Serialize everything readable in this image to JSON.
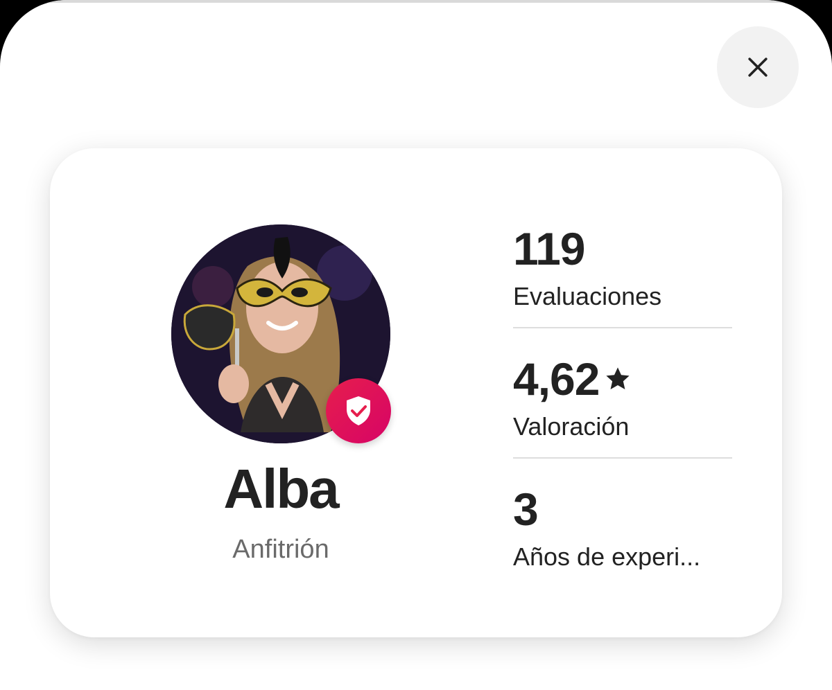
{
  "header": {
    "close_label": "close"
  },
  "host": {
    "name": "Alba",
    "role": "Anfitrión",
    "verified": true
  },
  "stats": [
    {
      "value": "119",
      "label": "Evaluaciones"
    },
    {
      "value": "4,62",
      "label": "Valoración",
      "icon": "star-icon"
    },
    {
      "value": "3",
      "label": "Años de experi..."
    }
  ],
  "colors": {
    "accent": "#E61E4D",
    "text": "#222222",
    "muted": "#6A6A6A"
  }
}
